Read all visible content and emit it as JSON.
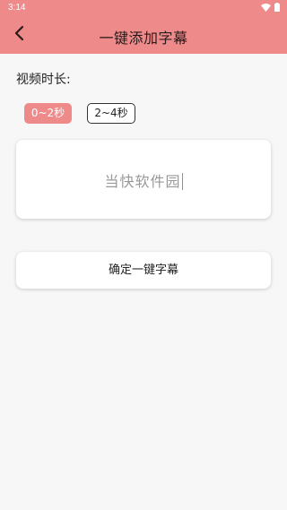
{
  "status_bar": {
    "time": "3:14",
    "icons": [
      "wifi-icon",
      "battery-icon"
    ]
  },
  "app_bar": {
    "back_icon": "chevron-left-icon",
    "title": "一键添加字幕"
  },
  "duration": {
    "label": "视频时长:",
    "options": [
      {
        "label": "0~2秒",
        "selected": true
      },
      {
        "label": "2~4秒",
        "selected": false
      }
    ]
  },
  "text_area": {
    "value": "当快软件园"
  },
  "confirm_button": {
    "label": "确定一键字幕"
  },
  "colors": {
    "accent": "#ee8a8a",
    "background": "#f7f7f7",
    "card": "#ffffff",
    "placeholder_text": "#999999"
  }
}
